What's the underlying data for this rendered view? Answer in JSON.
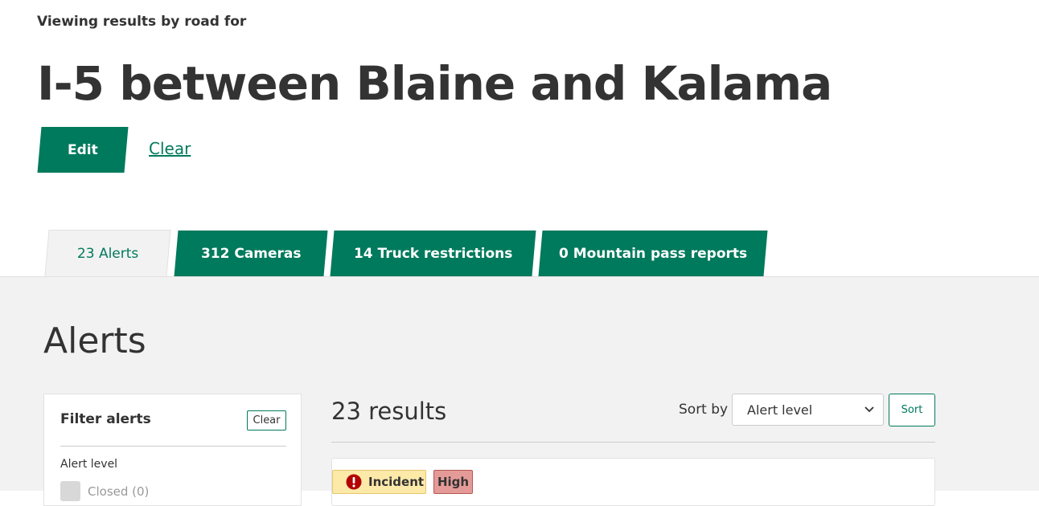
{
  "header": {
    "eyebrow": "Viewing results by road for",
    "title": "I-5 between Blaine and Kalama",
    "edit_label": "Edit",
    "clear_label": "Clear"
  },
  "tabs": [
    {
      "label": "23 Alerts",
      "active": true
    },
    {
      "label": "312 Cameras",
      "active": false
    },
    {
      "label": "14 Truck restrictions",
      "active": false
    },
    {
      "label": "0 Mountain pass reports",
      "active": false
    }
  ],
  "section": {
    "title": "Alerts"
  },
  "filter": {
    "title": "Filter alerts",
    "clear_label": "Clear",
    "alert_level_label": "Alert level",
    "options": [
      {
        "label": "Closed (0)",
        "checked": false
      }
    ]
  },
  "results": {
    "count_label": "23 results",
    "sort_label": "Sort by",
    "sort_selected": "Alert level",
    "sort_button": "Sort"
  },
  "alerts": [
    {
      "type": "Incident",
      "level": "High"
    }
  ],
  "icons": {
    "incident": "exclamation-circle-icon",
    "select_chevron": "chevron-down-icon"
  },
  "colors": {
    "brand_green": "#007a5c",
    "panel_bg": "#f2f2f2",
    "incident_badge": "#fde9a8",
    "high_badge": "#e49b98",
    "incident_icon": "#b30000"
  }
}
